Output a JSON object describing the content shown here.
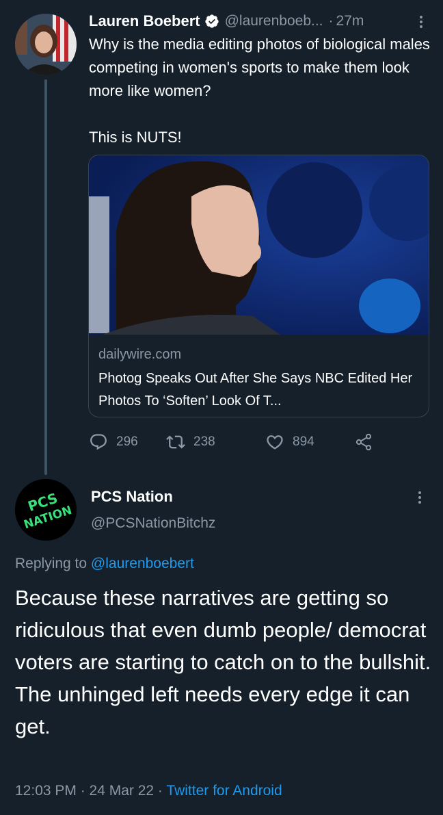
{
  "tweet": {
    "author_name": "Lauren Boebert",
    "handle": "@laurenboeb...",
    "separator": "·",
    "time": "27m",
    "text": "Why is the media editing photos of biological males competing in women's sports to make them look more like women?\n\nThis is NUTS!",
    "card": {
      "domain": "dailywire.com",
      "title": "Photog Speaks Out After She Says NBC Edited Her Photos To ‘Soften’ Look Of T..."
    },
    "actions": {
      "replies": "296",
      "retweets": "238",
      "likes": "894"
    }
  },
  "reply": {
    "author_name": "PCS Nation",
    "handle": "@PCSNationBitchz",
    "avatar_text": "PCS NATION",
    "replying_prefix": "Replying to",
    "replying_to": "@laurenboebert",
    "text": "Because these narratives are getting so ridiculous that even dumb people/ democrat voters are starting to catch on to the bullshit.\nThe unhinged left needs every edge it can get.",
    "timestamp": "12:03 PM · 24 Mar 22 ·",
    "source": "Twitter for Android"
  },
  "colors": {
    "background": "#15202b",
    "text_primary": "#ffffff",
    "text_secondary": "#8b98a5",
    "link": "#1d9bf0",
    "border": "#38444d",
    "avatar_text_green": "#39e07a"
  },
  "icons": [
    "verified-badge-icon",
    "more-vertical-icon",
    "reply-icon",
    "retweet-icon",
    "like-icon",
    "share-icon"
  ]
}
